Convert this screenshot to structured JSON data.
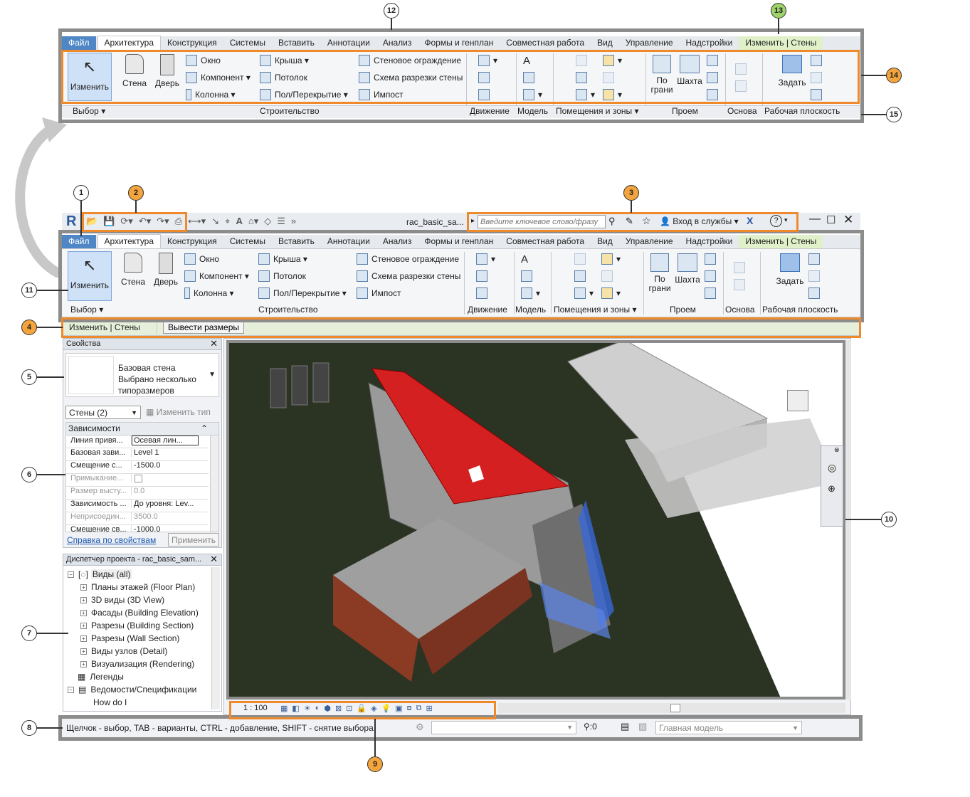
{
  "callouts": {
    "c1": "1",
    "c2": "2",
    "c3": "3",
    "c4": "4",
    "c5": "5",
    "c6": "6",
    "c7": "7",
    "c8": "8",
    "c9": "9",
    "c10": "10",
    "c11": "11",
    "c12": "12",
    "c13": "13",
    "c14": "14",
    "c15": "15"
  },
  "titlebar": {
    "logo": "R",
    "file_name": "rac_basic_sa...",
    "search_placeholder": "Введите ключевое слово/фразу",
    "signin": "Вход в службы",
    "help": "?"
  },
  "tabs": [
    "Файл",
    "Архитектура",
    "Конструкция",
    "Системы",
    "Вставить",
    "Аннотации",
    "Анализ",
    "Формы и генплан",
    "Совместная работа",
    "Вид",
    "Управление",
    "Надстройки",
    "Изменить | Стены"
  ],
  "ribbon": {
    "modify": "Изменить",
    "wall": "Стена",
    "door": "Дверь",
    "window": "Окно",
    "component": "Компонент",
    "column": "Колонна",
    "roof": "Крыша",
    "ceiling": "Потолок",
    "floor": "Пол/Перекрытие",
    "curtain_system": "Стеновое ограждение",
    "curtain_grid": "Схема разрезки стены",
    "mullion": "Импост",
    "by_face": "По\nграни",
    "shaft": "Шахта",
    "set": "Задать",
    "panels": {
      "select": "Выбор",
      "build": "Строительство",
      "circulation": "Движение",
      "model": "Модель",
      "room": "Помещения и зоны",
      "opening": "Проем",
      "datum": "Основа",
      "workplane": "Рабочая плоскость"
    }
  },
  "optionsbar": {
    "context": "Изменить | Стены",
    "button": "Вывести размеры"
  },
  "properties": {
    "title": "Свойства",
    "type_line1": "Базовая стена",
    "type_line2": "Выбрано несколько",
    "type_line3": "типоразмеров",
    "filter": "Стены (2)",
    "edit_type": "Изменить тип",
    "group": "Зависимости",
    "rows": [
      [
        "Линия привя...",
        "Осевая лин..."
      ],
      [
        "Базовая зави...",
        "Level 1"
      ],
      [
        "Смещение с...",
        "-1500.0"
      ],
      [
        "Примыкание...",
        ""
      ],
      [
        "Размер высту...",
        "0.0"
      ],
      [
        "Зависимость ...",
        "До уровня: Lev..."
      ],
      [
        "Неприсоедин...",
        "3500.0"
      ],
      [
        "Смещение св...",
        "-1000.0"
      ]
    ],
    "help_link": "Справка по свойствам",
    "apply": "Применить"
  },
  "browser": {
    "title": "Диспетчер проекта - rac_basic_sam...",
    "items": [
      "Виды (all)",
      "Планы этажей (Floor Plan)",
      "3D виды (3D View)",
      "Фасады (Building Elevation)",
      "Разрезы (Building Section)",
      "Разрезы (Wall Section)",
      "Виды узлов (Detail)",
      "Визуализация (Rendering)",
      "Легенды",
      "Ведомости/Спецификации",
      "How do I"
    ]
  },
  "viewbar": {
    "scale": "1 : 100"
  },
  "statusbar": {
    "text": "Щелчок - выбор, TAB - варианты, CTRL - добавление, SHIFT - снятие выбора.",
    "count": ":0",
    "model": "Главная модель"
  },
  "colors": {
    "accent": "#ef8a2c",
    "frame": "#8c8c8c",
    "file_tab": "#4f86c6",
    "roof": "#d42020",
    "ground": "#2b3323"
  }
}
